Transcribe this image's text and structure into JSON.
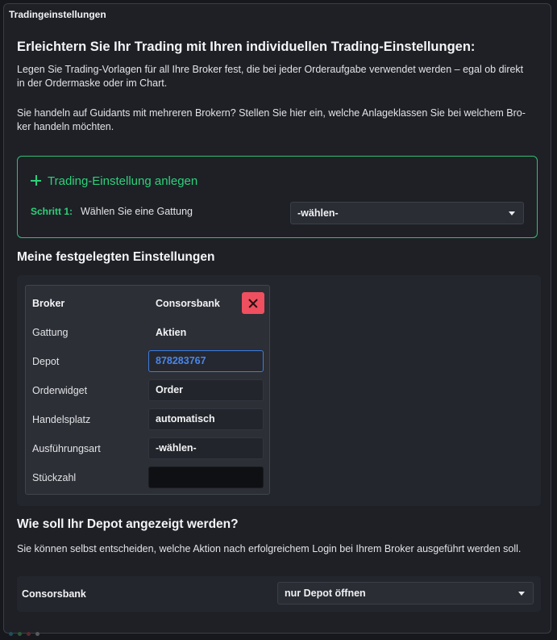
{
  "window": {
    "title": "Tradingeinstellungen"
  },
  "intro": {
    "heading": "Erleichtern Sie Ihr Trading mit Ihren individuellen Trading-Einstellungen:",
    "p1_line1": "Legen Sie Trading-Vorlagen für all Ihre Broker fest, die bei jeder Orderaufgabe verwendet werden – egal ob direkt",
    "p1_line2": "in der Ordermaske oder im Chart.",
    "p2_line1": "Sie handeln auf Guidants mit mehreren Brokern? Stellen Sie hier ein, welche Anlageklassen Sie bei welchem Bro-",
    "p2_line2": "ker handeln möchten."
  },
  "create": {
    "link_label": "Trading-Einstellung anlegen",
    "step_label": "Schritt 1:",
    "step_text": "Wählen Sie eine Gattung",
    "select_value": "-wählen-",
    "accent": "#2fd07a"
  },
  "settings": {
    "heading": "Meine festgelegten Einstellungen",
    "card": {
      "broker_label": "Broker",
      "broker_value": "Consorsbank",
      "gattung_label": "Gattung",
      "gattung_value": "Aktien",
      "depot_label": "Depot",
      "depot_value": "878283767",
      "orderwidget_label": "Orderwidget",
      "orderwidget_value": "Order",
      "handelsplatz_label": "Handelsplatz",
      "handelsplatz_value": "automatisch",
      "ausfuehrungsart_label": "Ausführungsart",
      "ausfuehrungsart_value": "-wählen-",
      "stueckzahl_label": "Stückzahl",
      "stueckzahl_value": "",
      "delete_color": "#ef4f5f"
    }
  },
  "depot_display": {
    "heading": "Wie soll Ihr Depot angezeigt werden?",
    "text": "Sie können selbst entscheiden, welche Aktion nach erfolgreichem Login bei Ihrem Broker ausgeführt werden soll.",
    "broker_label": "Consorsbank",
    "select_value": "nur Depot öffnen"
  },
  "footer": {
    "dot_colors": [
      "#1f4e5a",
      "#2a5a3a",
      "#5a2a30",
      "#555a60"
    ]
  }
}
